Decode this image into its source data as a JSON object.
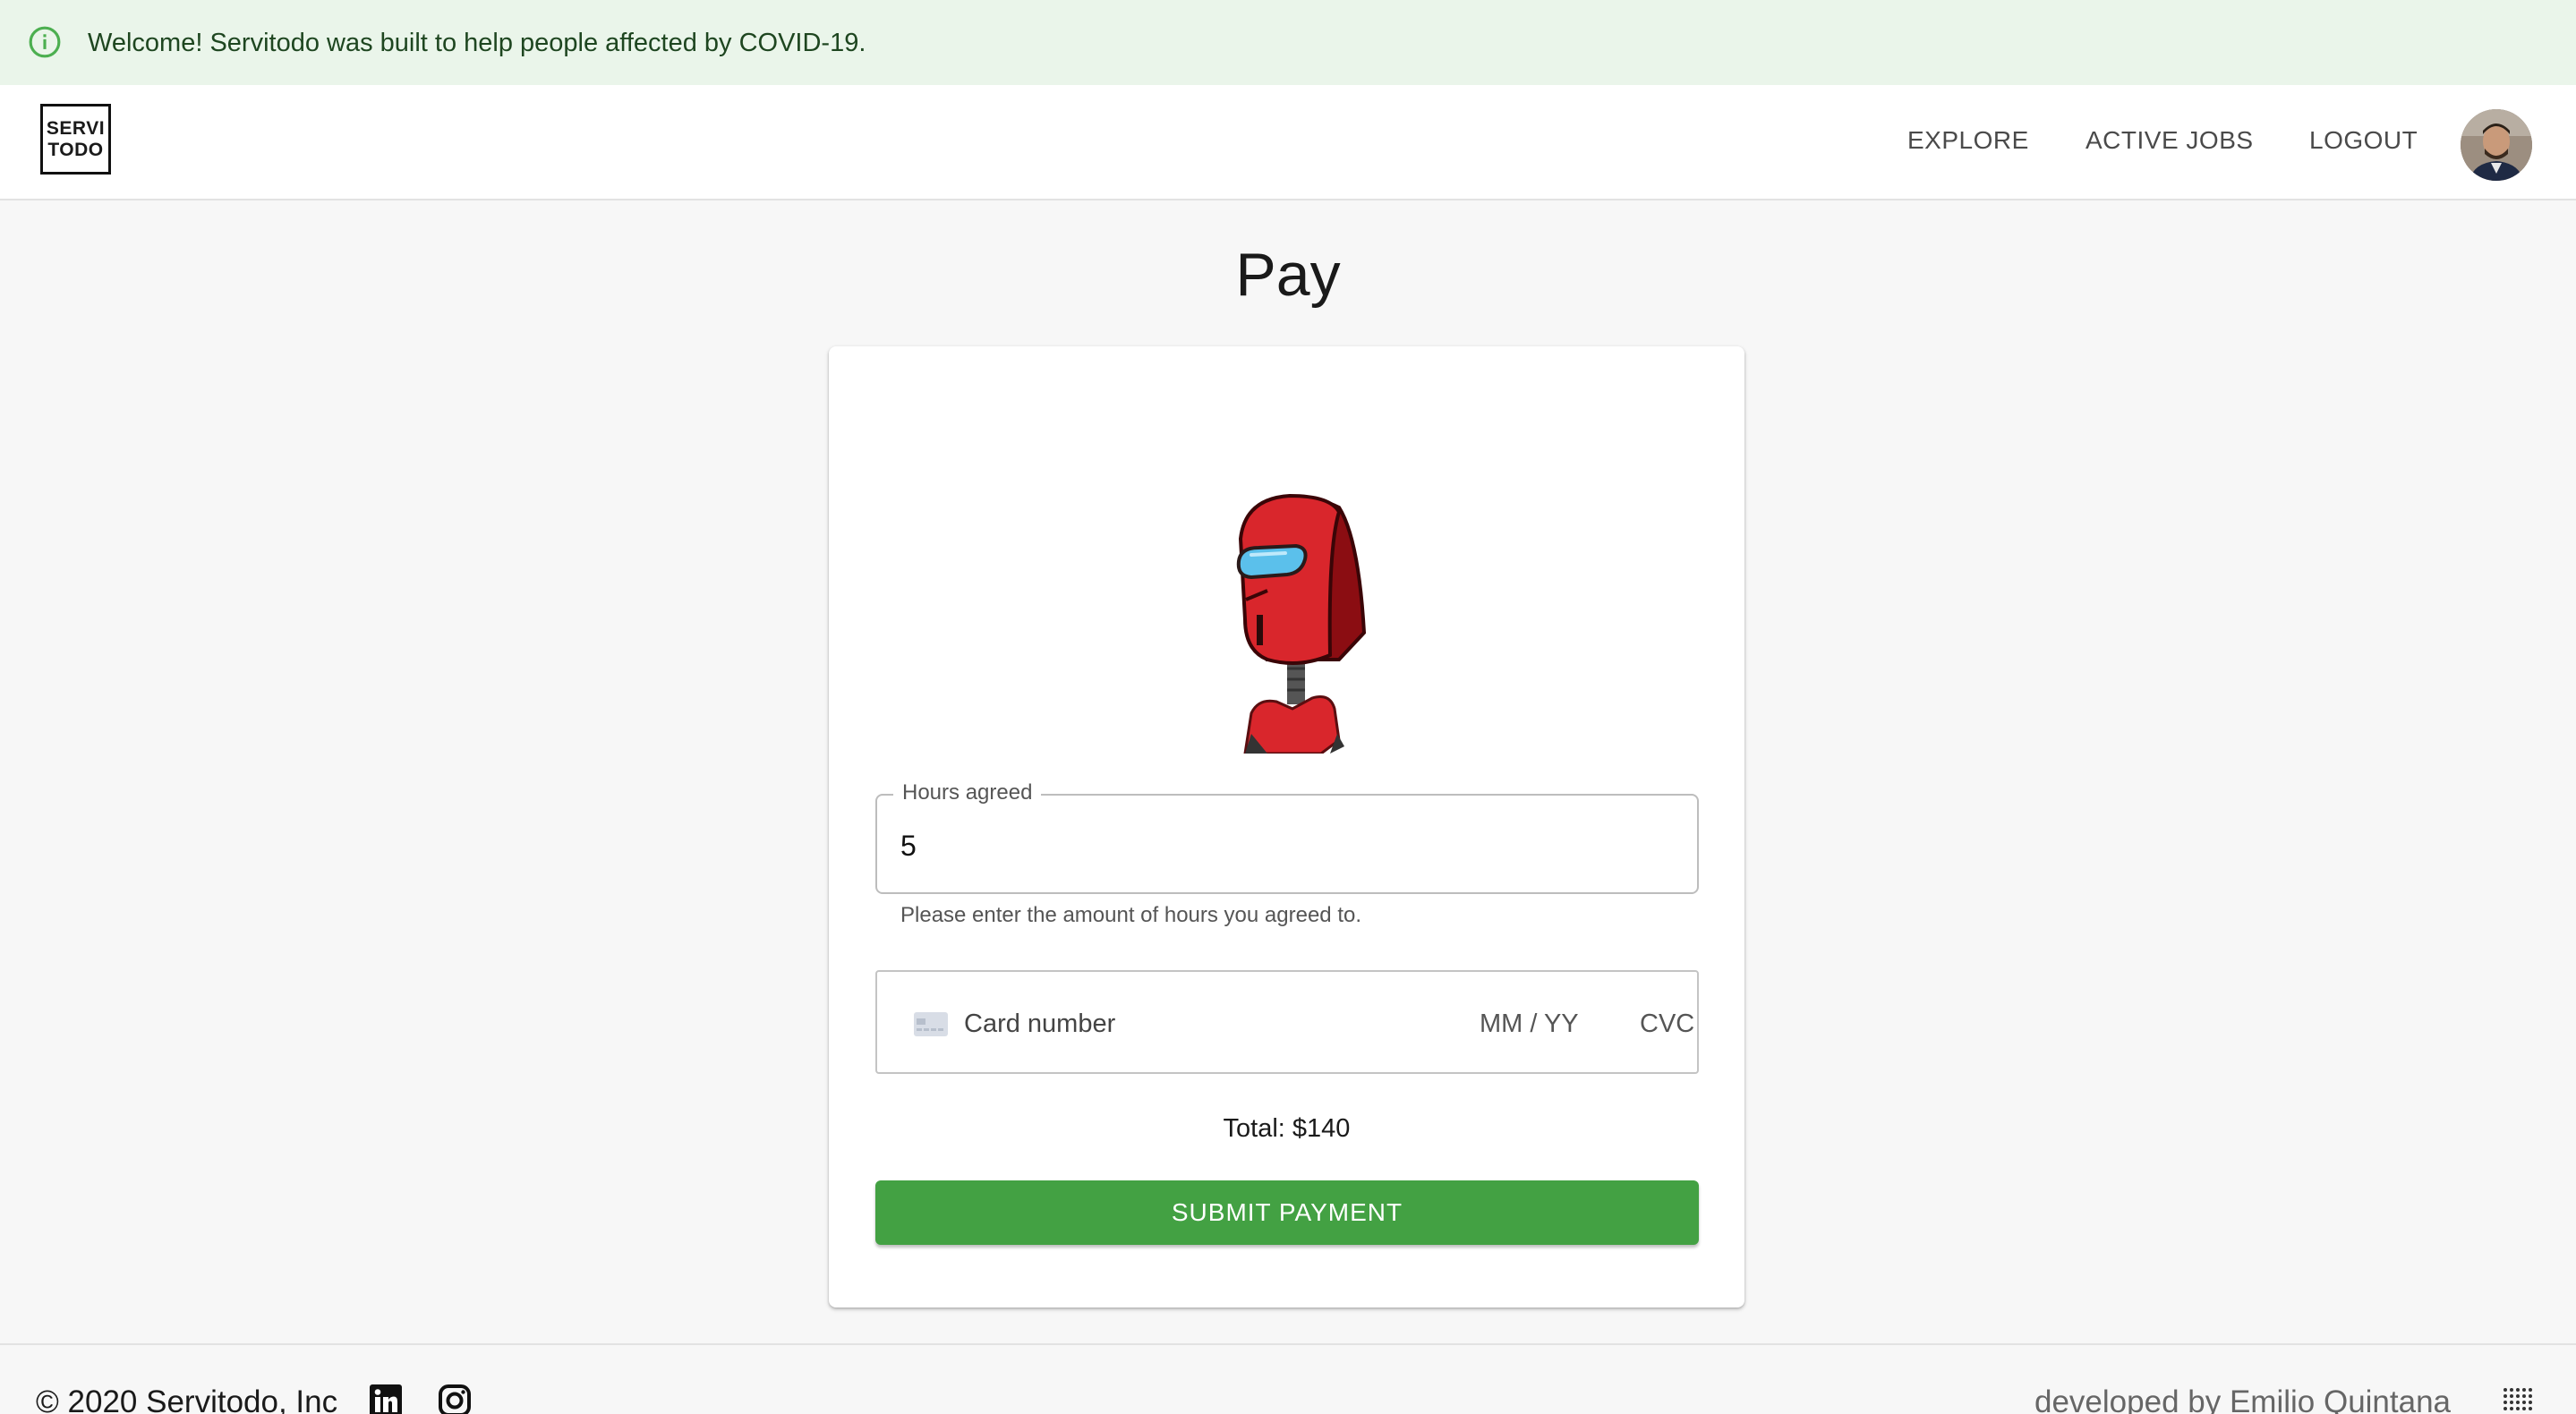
{
  "alert": {
    "icon": "info-icon",
    "message": "Welcome! Servitodo was built to help people affected by COVID-19."
  },
  "navbar": {
    "logo_line1": "SERVI",
    "logo_line2": "TODO",
    "links": [
      "EXPLORE",
      "ACTIVE JOBS",
      "LOGOUT"
    ],
    "avatar_icon": "user-avatar"
  },
  "page": {
    "title": "Pay"
  },
  "form": {
    "hours_label": "Hours agreed",
    "hours_value": "5",
    "hours_helper": "Please enter the amount of hours you agreed to.",
    "card_number_placeholder": "Card number",
    "card_expiry_placeholder": "MM / YY",
    "card_cvc_placeholder": "CVC",
    "total": "Total: $140",
    "submit_label": "SUBMIT PAYMENT"
  },
  "footer": {
    "copyright": "© 2020 Servitodo, Inc",
    "social_icons": [
      "linkedin-icon",
      "instagram-icon"
    ],
    "developer_credit": "developed by Emilio Quintana"
  },
  "colors": {
    "alert_bg": "#eaf5ea",
    "alert_icon": "#4caf50",
    "primary_button": "#43a143",
    "robot_red": "#d9262c",
    "visor_blue": "#5bc0eb"
  }
}
